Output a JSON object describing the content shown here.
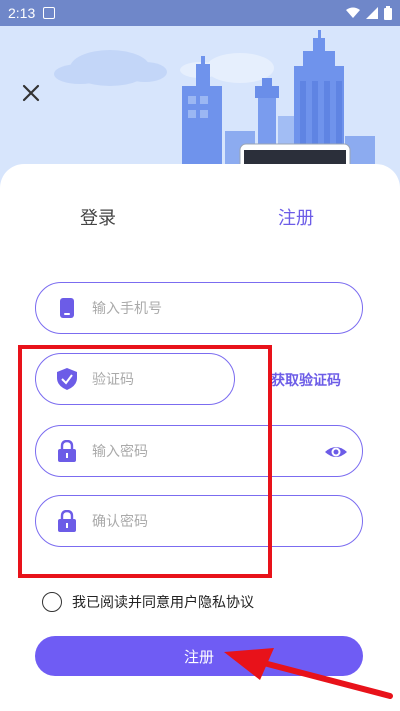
{
  "statusbar": {
    "time": "2:13"
  },
  "tabs": {
    "login": "登录",
    "register": "注册"
  },
  "form": {
    "phone_placeholder": "输入手机号",
    "code_placeholder": "验证码",
    "get_code": "获取验证码",
    "password_placeholder": "输入密码",
    "confirm_placeholder": "确认密码",
    "agreement": "我已阅读并同意用户隐私协议",
    "submit": "注册"
  },
  "colors": {
    "accent": "#6c5ce7",
    "button": "#6f5cf4",
    "highlight": "#e8121a",
    "statusbar": "#6f87c9"
  },
  "icons": [
    "close-icon",
    "phone-icon",
    "shield-icon",
    "lock-icon",
    "eye-icon",
    "wifi-icon",
    "signal-icon",
    "battery-icon"
  ]
}
